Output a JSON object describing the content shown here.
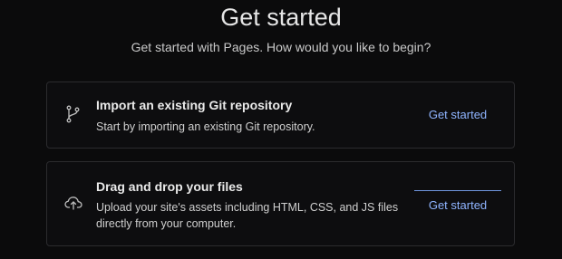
{
  "page": {
    "title": "Get started",
    "subtitle": "Get started with Pages. How would you like to begin?"
  },
  "options": [
    {
      "icon": "git-branch-icon",
      "title": "Import an existing Git repository",
      "description": "Start by importing an existing Git repository.",
      "button_label": "Get started"
    },
    {
      "icon": "cloud-upload-icon",
      "title": "Drag and drop your files",
      "description": "Upload your site's assets including HTML, CSS, and JS files directly from your computer.",
      "button_label": "Get started"
    }
  ],
  "colors": {
    "background": "#0b0b0c",
    "card_border": "#2b2b2e",
    "link": "#8fb4ff"
  }
}
